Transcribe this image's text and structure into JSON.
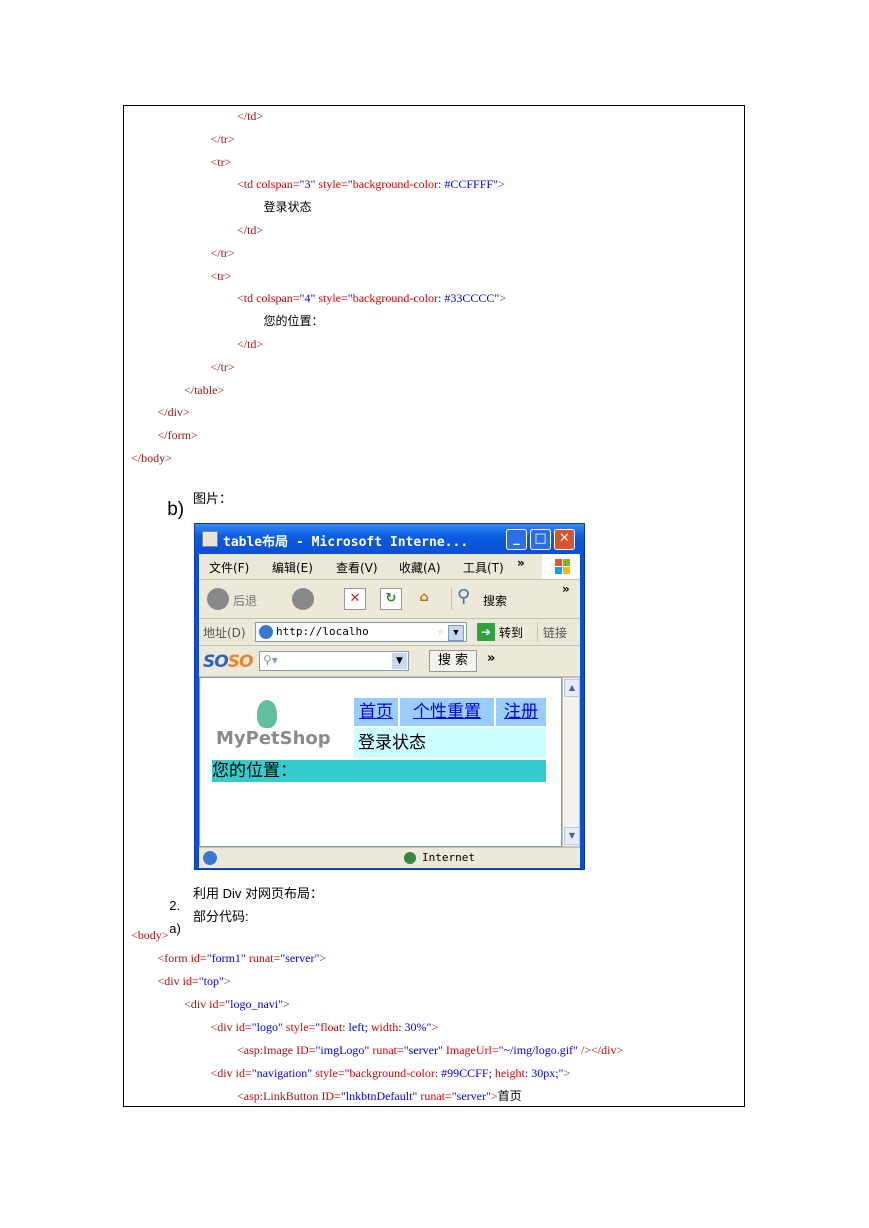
{
  "code_top": [
    {
      "indent": 4,
      "parts": [
        [
          "tag",
          "</td>"
        ]
      ]
    },
    {
      "indent": 3,
      "parts": [
        [
          "tag",
          "</tr>"
        ]
      ]
    },
    {
      "indent": 3,
      "parts": [
        [
          "tag",
          "<tr>"
        ]
      ]
    },
    {
      "indent": 4,
      "parts": [
        [
          "tag",
          "<td "
        ],
        [
          "attr",
          "colspan="
        ],
        [
          "val",
          "\"3\""
        ],
        [
          "attr",
          " style="
        ],
        [
          "val",
          "\""
        ],
        [
          "attr",
          "background-color"
        ],
        [
          "val",
          ": #CCFFFF\""
        ],
        [
          "tag",
          ">"
        ]
      ]
    },
    {
      "indent": 5,
      "parts": [
        [
          "txt",
          "登录状态"
        ]
      ]
    },
    {
      "indent": 4,
      "parts": [
        [
          "tag",
          "</td>"
        ]
      ]
    },
    {
      "indent": 3,
      "parts": [
        [
          "tag",
          "</tr>"
        ]
      ]
    },
    {
      "indent": 3,
      "parts": [
        [
          "tag",
          "<tr>"
        ]
      ]
    },
    {
      "indent": 4,
      "parts": [
        [
          "tag",
          "<td "
        ],
        [
          "attr",
          "colspan="
        ],
        [
          "val",
          "\"4\""
        ],
        [
          "attr",
          " style="
        ],
        [
          "val",
          "\""
        ],
        [
          "attr",
          "background-color"
        ],
        [
          "val",
          ": #33CCCC\""
        ],
        [
          "tag",
          ">"
        ]
      ]
    },
    {
      "indent": 5,
      "parts": [
        [
          "txt",
          "您的位置："
        ]
      ]
    },
    {
      "indent": 4,
      "parts": [
        [
          "tag",
          "</td>"
        ]
      ]
    },
    {
      "indent": 3,
      "parts": [
        [
          "tag",
          "</tr>"
        ]
      ]
    },
    {
      "indent": 2,
      "parts": [
        [
          "tag",
          "</table>"
        ]
      ]
    },
    {
      "indent": 1,
      "parts": [
        [
          "tag",
          "</div>"
        ]
      ]
    },
    {
      "indent": 1,
      "parts": [
        [
          "tag",
          "</form>"
        ]
      ]
    },
    {
      "indent": 0,
      "parts": [
        [
          "tag",
          "</body>"
        ]
      ]
    }
  ],
  "section_b": {
    "marker": "b)",
    "label": "图片："
  },
  "screenshot": {
    "title": "table布局 - Microsoft Interne...",
    "menus": [
      "文件(F)",
      "编辑(E)",
      "查看(V)",
      "收藏(A)",
      "工具(T)"
    ],
    "menu_more": "»",
    "back_label": "后退",
    "search_label": "搜索",
    "toolbar_more": "»",
    "address_label": "地址(D)",
    "address_value": "http://localho",
    "go_label": "转到",
    "links_label": "链接",
    "soso_logo": "SOSO",
    "soso_search": "搜 索",
    "soso_more": "»",
    "page": {
      "logo_text": "MyPetShop",
      "nav": [
        "首页",
        "个性重置",
        "注册"
      ],
      "login": "登录状态",
      "position": "您的位置："
    },
    "status_zone": "Internet"
  },
  "section_2": {
    "number": "2.",
    "title": "利用 Div 对网页布局："
  },
  "section_a": {
    "marker": "a)",
    "label": "部分代码:"
  },
  "code_bottom": [
    {
      "indent": 0,
      "parts": [
        [
          "tag",
          "<body>"
        ]
      ]
    },
    {
      "indent": 1,
      "parts": [
        [
          "tag",
          "<form "
        ],
        [
          "attr",
          "id="
        ],
        [
          "val",
          "\"form1\""
        ],
        [
          "attr",
          " runat="
        ],
        [
          "val",
          "\"server\""
        ],
        [
          "tag",
          ">"
        ]
      ]
    },
    {
      "indent": 1,
      "parts": [
        [
          "tag",
          "<div "
        ],
        [
          "attr",
          "id="
        ],
        [
          "val",
          "\"top\""
        ],
        [
          "tag",
          ">"
        ]
      ]
    },
    {
      "indent": 2,
      "parts": [
        [
          "tag",
          "<div "
        ],
        [
          "attr",
          "id="
        ],
        [
          "val",
          "\"logo_navi\""
        ],
        [
          "tag",
          ">"
        ]
      ]
    },
    {
      "indent": 3,
      "parts": [
        [
          "tag",
          "<div "
        ],
        [
          "attr",
          "id="
        ],
        [
          "val",
          "\"logo\""
        ],
        [
          "attr",
          " style="
        ],
        [
          "val",
          "\""
        ],
        [
          "attr",
          "float"
        ],
        [
          "val",
          ": left; "
        ],
        [
          "attr",
          "width"
        ],
        [
          "val",
          ": 30%\""
        ],
        [
          "tag",
          ">"
        ]
      ]
    },
    {
      "indent": 4,
      "parts": [
        [
          "tag",
          "<asp:Image "
        ],
        [
          "attr",
          "ID="
        ],
        [
          "val",
          "\"imgLogo\""
        ],
        [
          "attr",
          " runat="
        ],
        [
          "val",
          "\"server\""
        ],
        [
          "attr",
          " ImageUrl="
        ],
        [
          "val",
          "\"~/img/logo.gif\""
        ],
        [
          "tag",
          " /></div>"
        ]
      ]
    },
    {
      "indent": 3,
      "parts": [
        [
          "tag",
          "<div "
        ],
        [
          "attr",
          "id="
        ],
        [
          "val",
          "\"navigation\""
        ],
        [
          "attr",
          " style="
        ],
        [
          "val",
          "\""
        ],
        [
          "attr",
          "background-color"
        ],
        [
          "val",
          ": #99CCFF; "
        ],
        [
          "attr",
          "height"
        ],
        [
          "val",
          ": 30px;\""
        ],
        [
          "tag",
          ">"
        ]
      ]
    },
    {
      "indent": 4,
      "parts": [
        [
          "tag",
          "<asp:LinkButton "
        ],
        [
          "attr",
          "ID="
        ],
        [
          "val",
          "\"lnkbtnDefault\""
        ],
        [
          "attr",
          " runat="
        ],
        [
          "val",
          "\"server\""
        ],
        [
          "tag",
          ">"
        ],
        [
          "txt",
          "首页"
        ]
      ]
    }
  ]
}
